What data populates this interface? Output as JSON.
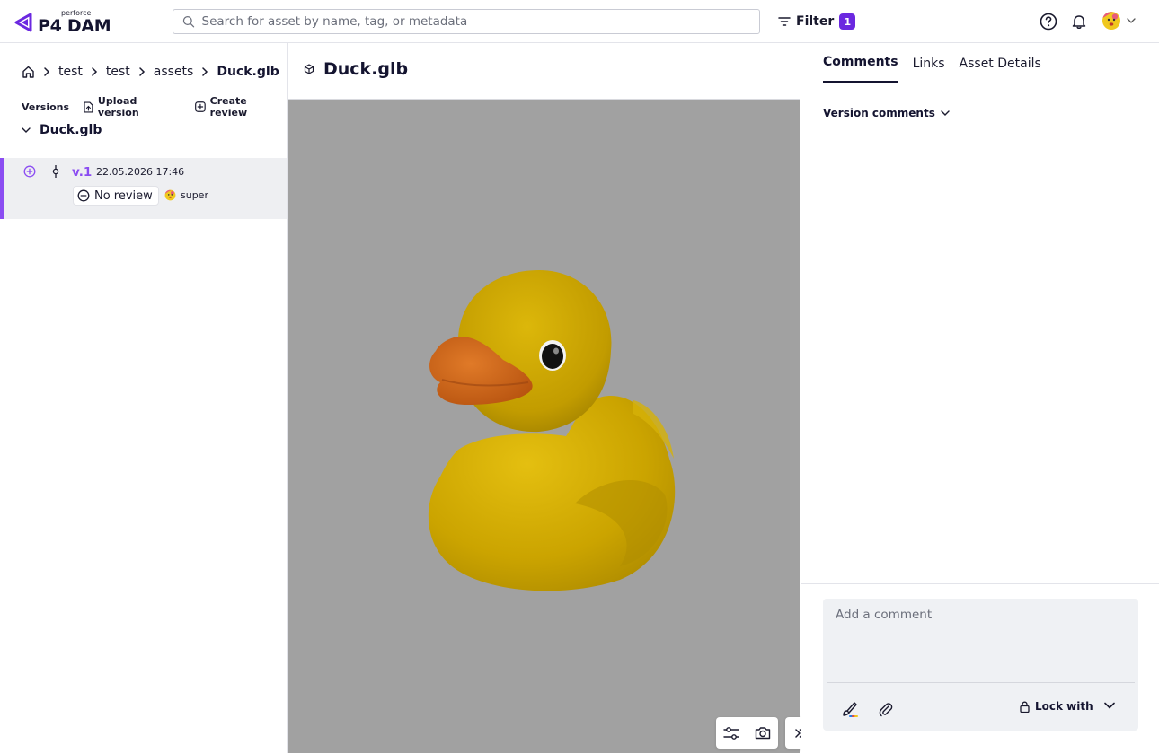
{
  "header": {
    "brand_small": "perforce",
    "brand": "P4 DAM",
    "search_placeholder": "Search for asset by name, tag, or metadata",
    "filter_label": "Filter",
    "filter_count": "1"
  },
  "breadcrumb": {
    "items": [
      "test",
      "test",
      "assets"
    ],
    "current": "Duck.glb"
  },
  "versions_bar": {
    "title": "Versions",
    "upload_label": "Upload version",
    "create_review_label": "Create review"
  },
  "tree": {
    "root_label": "Duck.glb",
    "version": {
      "label": "v.1",
      "date": "22.05.2026 17:46",
      "review_status": "No review",
      "user": "super"
    }
  },
  "asset": {
    "title": "Duck.glb"
  },
  "right_panel": {
    "tabs": [
      "Comments",
      "Links",
      "Asset Details"
    ],
    "active_tab": "Comments",
    "version_comments_label": "Version comments",
    "comment_placeholder": "Add a comment",
    "lock_label": "Lock with"
  },
  "colors": {
    "accent": "#8b4df2",
    "badge": "#6b28e0",
    "viewport_bg": "#a1a1a1"
  }
}
